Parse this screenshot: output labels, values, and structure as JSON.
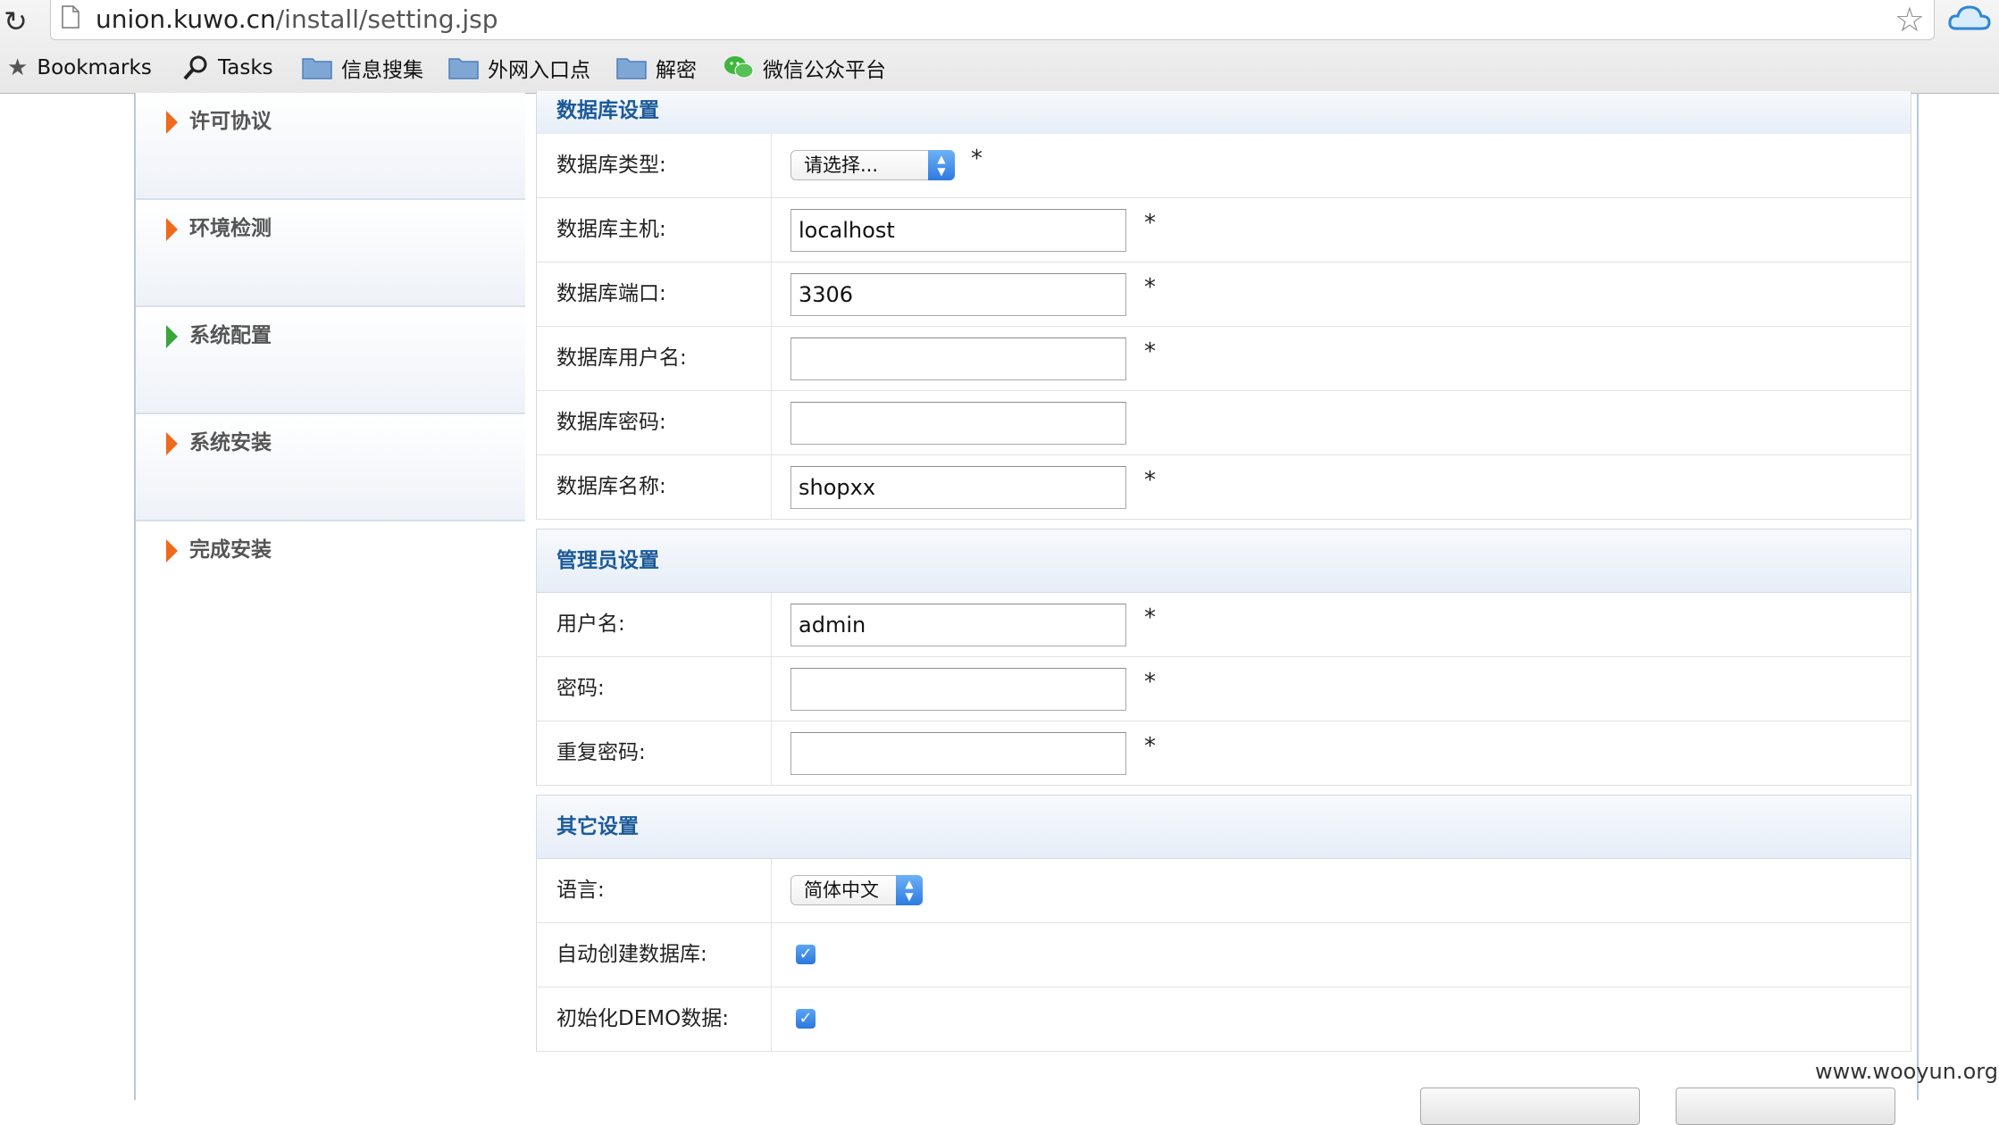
{
  "browser": {
    "url_host": "union.kuwo.cn",
    "url_path": "/install/setting.jsp",
    "bookmarks": [
      {
        "label": "Bookmarks",
        "icon": "star-icon"
      },
      {
        "label": "Tasks",
        "icon": "magnifier-icon"
      },
      {
        "label": "信息搜集",
        "icon": "folder-icon"
      },
      {
        "label": "外网入口点",
        "icon": "folder-icon"
      },
      {
        "label": "解密",
        "icon": "folder-icon"
      },
      {
        "label": "微信公众平台",
        "icon": "wechat-icon"
      }
    ]
  },
  "sidebar": {
    "items": [
      {
        "label": "许可协议",
        "arrow_color": "#ee6a1c"
      },
      {
        "label": "环境检测",
        "arrow_color": "#ee6a1c"
      },
      {
        "label": "系统配置",
        "arrow_color": "#3aa53a"
      },
      {
        "label": "系统安装",
        "arrow_color": "#ee6a1c"
      },
      {
        "label": "完成安装",
        "arrow_color": "#ee6a1c"
      }
    ]
  },
  "database": {
    "title": "数据库设置",
    "type_label": "数据库类型:",
    "type_value": "请选择...",
    "host_label": "数据库主机:",
    "host_value": "localhost",
    "port_label": "数据库端口:",
    "port_value": "3306",
    "user_label": "数据库用户名:",
    "user_value": "",
    "password_label": "数据库密码:",
    "password_value": "",
    "name_label": "数据库名称:",
    "name_value": "shopxx",
    "required_mark": "*"
  },
  "admin": {
    "title": "管理员设置",
    "username_label": "用户名:",
    "username_value": "admin",
    "password_label": "密码:",
    "password_value": "",
    "repeat_label": "重复密码:",
    "repeat_value": ""
  },
  "other": {
    "title": "其它设置",
    "language_label": "语言:",
    "language_value": "简体中文",
    "auto_create_label": "自动创建数据库:",
    "auto_create_checked": true,
    "init_demo_label": "初始化DEMO数据:",
    "init_demo_checked": true
  },
  "watermark": "www.wooyun.org"
}
